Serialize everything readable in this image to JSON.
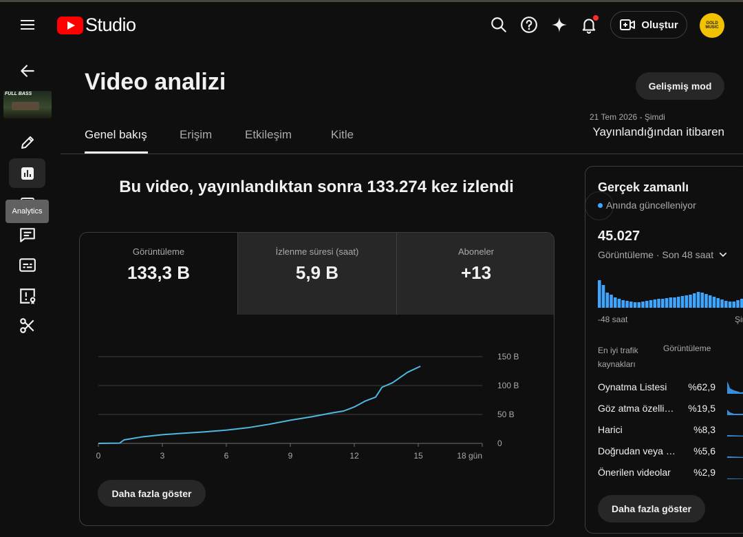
{
  "header": {
    "logo_text": "Studio",
    "create_label": "Oluştur",
    "avatar_text": "GOLD MUSIC"
  },
  "sidebar": {
    "video_thumb_text": "FULL BASS",
    "tooltip": "Analytics"
  },
  "page": {
    "title": "Video analizi",
    "advanced_mode": "Gelişmiş mod",
    "date_range_small": "21 Tem 2026 - Şimdi",
    "date_range_main": "Yayınlandığından itibaren",
    "tabs": [
      "Genel bakış",
      "Erişim",
      "Etkileşim",
      "Kitle"
    ],
    "headline": "Bu video, yayınlandıktan sonra 133.274 kez izlendi"
  },
  "metrics": [
    {
      "label": "Görüntüleme",
      "value": "133,3 B"
    },
    {
      "label": "İzlenme süresi (saat)",
      "value": "5,9 B"
    },
    {
      "label": "Aboneler",
      "value": "+13"
    }
  ],
  "chart_data": {
    "type": "line",
    "title": "",
    "xlabel": "",
    "ylabel": "",
    "x_ticks": [
      "0",
      "3",
      "6",
      "9",
      "12",
      "15",
      "18 gün"
    ],
    "y_ticks": [
      "0",
      "50 B",
      "100 B",
      "150 B"
    ],
    "xlim": [
      0,
      18
    ],
    "ylim": [
      0,
      150000
    ],
    "grid": true,
    "series": [
      {
        "x": [
          0,
          1,
          1.2,
          2,
          3,
          4,
          5,
          6,
          7,
          8,
          9,
          10,
          11,
          11.5,
          12,
          12.5,
          13,
          13.3,
          13.8,
          14.5,
          15.1
        ],
        "y": [
          0,
          500,
          6000,
          11000,
          15000,
          17500,
          20000,
          23000,
          27000,
          33000,
          40000,
          46000,
          53000,
          56000,
          63000,
          73000,
          80000,
          97000,
          105000,
          123000,
          133274
        ],
        "color": "#4fb8e0"
      }
    ]
  },
  "more_button": "Daha fazla göster",
  "realtime": {
    "title": "Gerçek zamanlı",
    "subtitle": "Anında güncelleniyor",
    "count": "45.027",
    "period": "Görüntüleme · Son 48 saat",
    "axis_left": "-48 saat",
    "axis_right": "Şimdi",
    "bars": [
      40,
      33,
      22,
      19,
      15,
      13,
      11,
      10,
      9,
      8,
      8,
      9,
      10,
      11,
      12,
      13,
      13,
      14,
      15,
      15,
      16,
      17,
      18,
      19,
      21,
      23,
      22,
      20,
      18,
      16,
      14,
      12,
      10,
      9,
      9,
      11,
      13,
      15,
      16,
      17
    ],
    "bar_color": "#3ea6ff",
    "col_source": "En iyi trafik kaynakları",
    "col_views": "Görüntüleme",
    "sources": [
      {
        "name": "Oynatma Listesi",
        "pct": "%62,9"
      },
      {
        "name": "Göz atma özellikleri",
        "pct": "%19,5"
      },
      {
        "name": "Harici",
        "pct": "%8,3"
      },
      {
        "name": "Doğrudan veya bilinmeyen",
        "pct": "%5,6"
      },
      {
        "name": "Önerilen videolar",
        "pct": "%2,9"
      }
    ],
    "more_button": "Daha fazla göster"
  }
}
